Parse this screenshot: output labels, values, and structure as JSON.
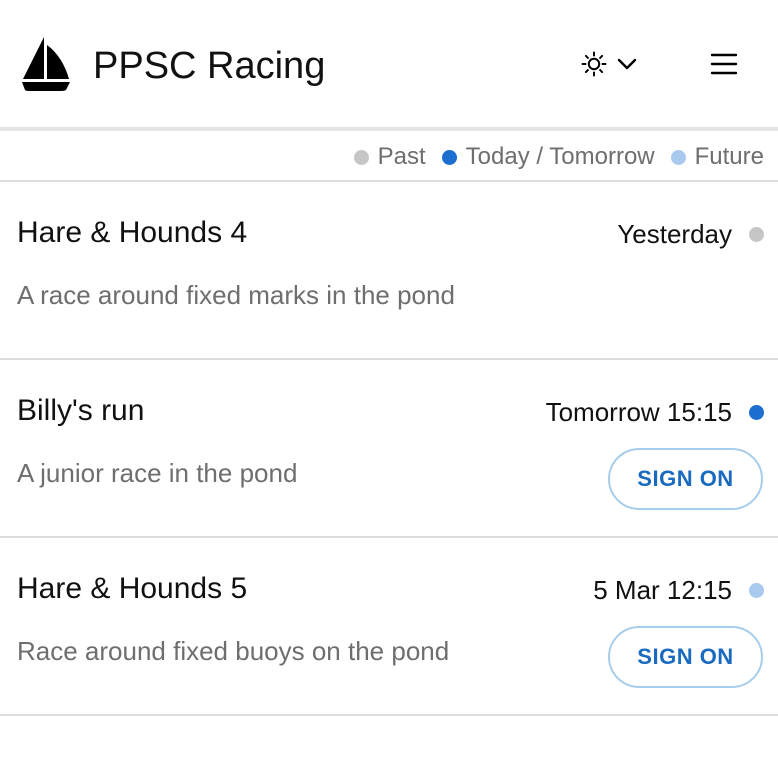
{
  "header": {
    "title": "PPSC Racing",
    "logo_icon": "sailboat-icon",
    "theme_icon": "sun-icon",
    "theme_dropdown_icon": "chevron-down-icon",
    "menu_icon": "hamburger-menu-icon"
  },
  "legend": {
    "items": [
      {
        "label": "Past",
        "color": "#c6c6c6"
      },
      {
        "label": "Today / Tomorrow",
        "color": "#1c6fd0"
      },
      {
        "label": "Future",
        "color": "#a9c9ee"
      }
    ]
  },
  "races": [
    {
      "name": "Hare & Hounds 4",
      "date": "Yesterday",
      "status": "past",
      "description": "A race around fixed marks in the pond",
      "button_label": ""
    },
    {
      "name": "Billy's run",
      "date": "Tomorrow 15:15",
      "status": "today-tomorrow",
      "description": "A junior race in the pond",
      "button_label": "SIGN ON"
    },
    {
      "name": "Hare & Hounds 5",
      "date": "5 Mar 12:15",
      "status": "future",
      "description": "Race around fixed buoys on the pond",
      "button_label": "SIGN ON"
    }
  ],
  "colors": {
    "accent": "#1a6bbf",
    "button_border": "#a6cdeb",
    "secondary_text": "#6e6e6e",
    "divider": "#dcdcdc"
  }
}
